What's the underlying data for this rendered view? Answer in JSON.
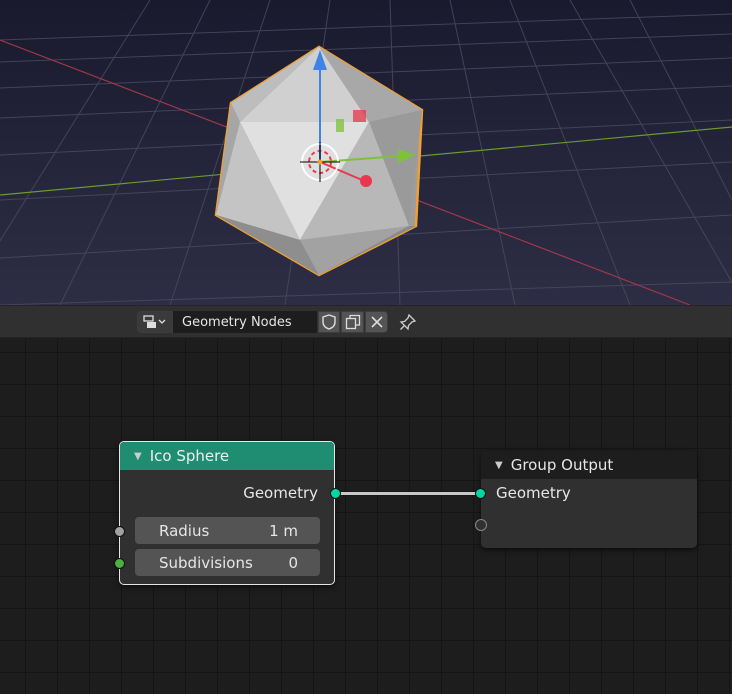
{
  "node_editor_header": {
    "tree_name": "Geometry Nodes",
    "icons": {
      "editor_type": "node-editor-icon",
      "fake_user": "shield-icon",
      "new_copy": "duplicate-icon",
      "unlink": "close-icon",
      "pin": "pin-icon"
    }
  },
  "nodes": {
    "ico_sphere": {
      "title": "Ico Sphere",
      "header_color": "#1e8d72",
      "output_label": "Geometry",
      "radius_label": "Radius",
      "radius_value": "1 m",
      "subdivisions_label": "Subdivisions",
      "subdivisions_value": "0"
    },
    "group_output": {
      "title": "Group Output",
      "input_label": "Geometry"
    }
  },
  "colors": {
    "geometry_socket": "#00d6a3",
    "float_socket": "#a1a1a1",
    "int_socket": "#4bb23d",
    "selection_outline": "#f0a030"
  }
}
